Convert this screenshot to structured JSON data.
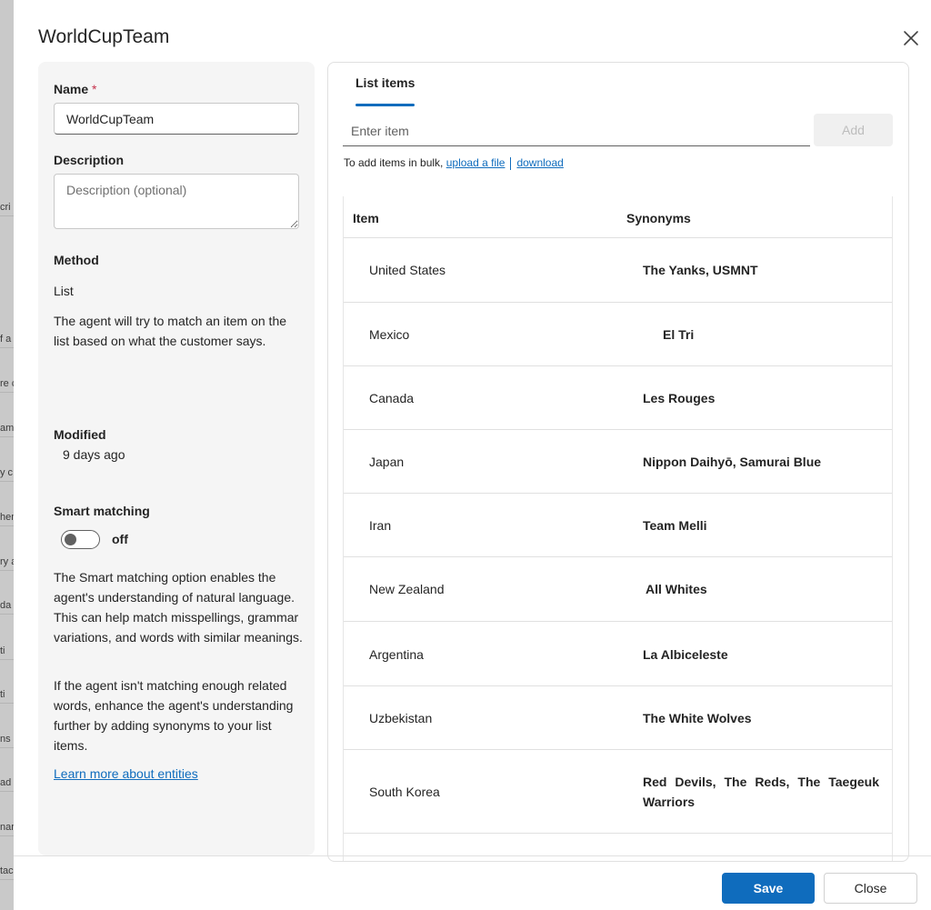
{
  "background_page": {
    "fragments": [
      "cri",
      "f a",
      "re c",
      "am",
      "y c",
      "hen",
      "ry a",
      "da",
      "ti",
      "ti",
      "ns",
      "ad",
      "nar",
      "tac"
    ]
  },
  "dialog": {
    "title": "WorldCupTeam",
    "close_icon": "close-icon"
  },
  "left_panel": {
    "name_label": "Name",
    "required_mark": "*",
    "name_value": "WorldCupTeam",
    "description_label": "Description",
    "description_placeholder": "Description (optional)",
    "method_label": "Method",
    "method_value": "List",
    "method_help": "The agent will try to match an item on the list based on what the customer says.",
    "modified_label": "Modified",
    "modified_value": "9 days ago",
    "smart_matching_label": "Smart matching",
    "smart_matching_state": "off",
    "smart_matching_help_1": "The Smart matching option enables the agent's understanding of natural language. This can help match misspellings, grammar variations, and words with similar meanings.",
    "smart_matching_help_2": "If the agent isn't matching enough related words, enhance the agent's understanding further by adding synonyms to your list items.",
    "learn_more_link": "Learn more about entities"
  },
  "right_panel": {
    "tab_label": "List items",
    "item_input_placeholder": "Enter item",
    "add_button": "Add",
    "bulk_prefix": "To add items in bulk,",
    "upload_link": "upload a file",
    "download_link": "download",
    "table": {
      "headers": [
        "Item",
        "Synonyms"
      ],
      "rows": [
        {
          "item": "United States",
          "synonyms": "The Yanks, USMNT"
        },
        {
          "item": "Mexico",
          "synonyms": "El Tri"
        },
        {
          "item": "Canada",
          "synonyms": "Les Rouges"
        },
        {
          "item": "Japan",
          "synonyms": "Nippon Daihyō, Samurai Blue"
        },
        {
          "item": "Iran",
          "synonyms": "Team Melli"
        },
        {
          "item": "New Zealand",
          "synonyms": "All Whites"
        },
        {
          "item": "Argentina",
          "synonyms": "La Albiceleste"
        },
        {
          "item": "Uzbekistan",
          "synonyms": "The White Wolves"
        },
        {
          "item": "South Korea",
          "synonyms": "Red Devils, The Reds, The Taegeuk Warriors"
        }
      ]
    }
  },
  "footer": {
    "save_button": "Save",
    "close_button": "Close"
  },
  "colors": {
    "accent": "#0f6cbd",
    "required": "#c4314b",
    "panel_bg": "#f5f5f5"
  }
}
